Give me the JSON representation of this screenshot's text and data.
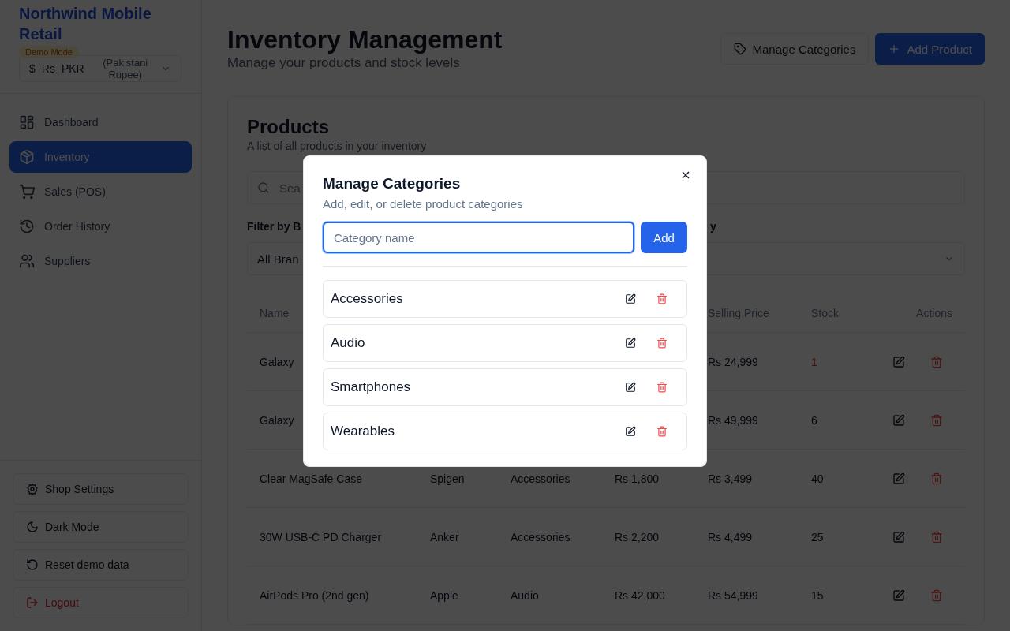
{
  "sidebar": {
    "brand": "Northwind Mobile Retail",
    "badge": "Demo Mode",
    "currency": {
      "icon": "$",
      "symbol": "Rs",
      "code": "PKR",
      "name": "(Pakistani Rupee)"
    },
    "nav": [
      {
        "label": "Dashboard",
        "selected": false
      },
      {
        "label": "Inventory",
        "selected": true
      },
      {
        "label": "Sales (POS)",
        "selected": false
      },
      {
        "label": "Order History",
        "selected": false
      },
      {
        "label": "Suppliers",
        "selected": false
      }
    ],
    "footer": [
      {
        "label": "Shop Settings",
        "kind": "normal"
      },
      {
        "label": "Dark Mode",
        "kind": "normal"
      },
      {
        "label": "Reset demo data",
        "kind": "normal"
      },
      {
        "label": "Logout",
        "kind": "danger"
      }
    ]
  },
  "header": {
    "title": "Inventory Management",
    "subtitle": "Manage your products and stock levels",
    "buttons": [
      {
        "label": "Manage Categories",
        "kind": "outline"
      },
      {
        "label": "Add Product",
        "kind": "primary"
      }
    ]
  },
  "products": {
    "title": "Products",
    "subtitle": "A list of all products in your inventory",
    "search_placeholder": "Sea",
    "brand_filter": {
      "label": "Filter by B",
      "value": "All Bran"
    },
    "category_filter": {
      "label": "y"
    },
    "columns": [
      "Name",
      "",
      "",
      "",
      "Selling Price",
      "Stock",
      "Actions"
    ],
    "rows": [
      {
        "name": "Galaxy",
        "brand": "",
        "category": "",
        "cost": "",
        "price": "Rs 24,999",
        "stock": "1",
        "low": true
      },
      {
        "name": "Galaxy",
        "brand": "",
        "category": "",
        "cost": "",
        "price": "Rs 49,999",
        "stock": "6",
        "low": false
      },
      {
        "name": "Clear MagSafe Case",
        "brand": "Spigen",
        "category": "Accessories",
        "cost": "Rs 1,800",
        "price": "Rs 3,499",
        "stock": "40",
        "low": false
      },
      {
        "name": "30W USB-C PD Charger",
        "brand": "Anker",
        "category": "Accessories",
        "cost": "Rs 2,200",
        "price": "Rs 4,499",
        "stock": "25",
        "low": false
      },
      {
        "name": "AirPods Pro (2nd gen)",
        "brand": "Apple",
        "category": "Audio",
        "cost": "Rs 42,000",
        "price": "Rs 54,999",
        "stock": "15",
        "low": false
      }
    ]
  },
  "dialog": {
    "title": "Manage Categories",
    "subtitle": "Add, edit, or delete product categories",
    "input_placeholder": "Category name",
    "add_button": "Add",
    "categories": [
      "Accessories",
      "Audio",
      "Smartphones",
      "Wearables"
    ]
  }
}
